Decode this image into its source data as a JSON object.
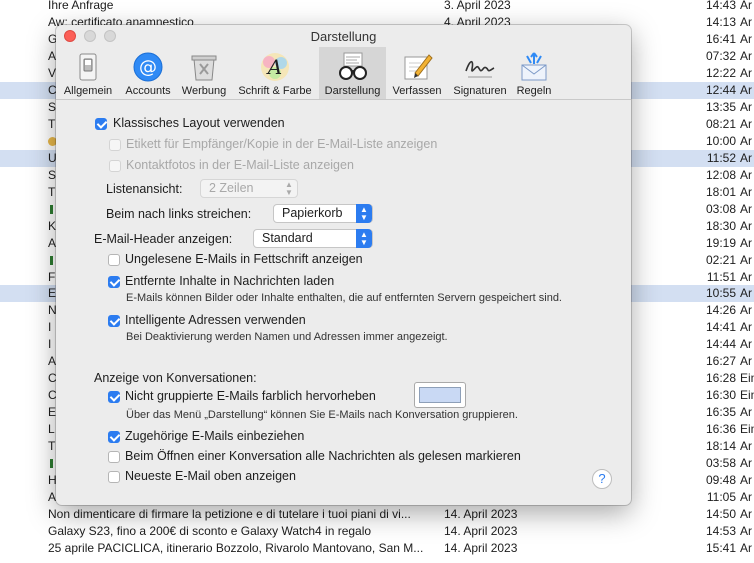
{
  "mail_list": [
    {
      "subject": "Ihre Anfrage",
      "date": "3. April 2023",
      "time": "14:43",
      "from": "Ar",
      "selected": false
    },
    {
      "subject": "Aw: certificato anamnestico",
      "date": "4. April 2023",
      "time": "14:13",
      "from": "Ar",
      "selected": false
    },
    {
      "subject": "G",
      "date": "",
      "time": "16:41",
      "from": "Ar",
      "selected": false
    },
    {
      "subject": "A",
      "date": "",
      "time": "07:32",
      "from": "Ar",
      "selected": false
    },
    {
      "subject": "V",
      "date": "",
      "time": "12:22",
      "from": "Ar",
      "selected": false
    },
    {
      "subject": "C",
      "date": "",
      "time": "12:44",
      "from": "Ar",
      "selected": true
    },
    {
      "subject": "S",
      "date": "",
      "time": "13:35",
      "from": "Ar",
      "selected": false
    },
    {
      "subject": "T",
      "date": "",
      "time": "08:21",
      "from": "Ar",
      "selected": false
    },
    {
      "subject": "",
      "date": "",
      "time": "10:00",
      "from": "Ar",
      "selected": false,
      "dot": true
    },
    {
      "subject": "U",
      "date": "",
      "time": "11:52",
      "from": "Ar",
      "selected": true
    },
    {
      "subject": "S",
      "date": "",
      "time": "12:08",
      "from": "Ar",
      "selected": false
    },
    {
      "subject": "T",
      "date": "",
      "time": "18:01",
      "from": "Ar",
      "selected": false
    },
    {
      "subject": "",
      "date": "",
      "time": "03:08",
      "from": "Ar",
      "selected": false,
      "flag": true
    },
    {
      "subject": "K",
      "date": "",
      "time": "18:30",
      "from": "Ar",
      "selected": false
    },
    {
      "subject": "A",
      "date": "",
      "time": "19:19",
      "from": "Ar",
      "selected": false
    },
    {
      "subject": "",
      "date": "",
      "time": "02:21",
      "from": "Ar",
      "selected": false,
      "flag": true
    },
    {
      "subject": "F",
      "date": "",
      "time": "11:51",
      "from": "Ar",
      "selected": false
    },
    {
      "subject": "E",
      "date": "",
      "time": "10:55",
      "from": "Ar",
      "selected": true
    },
    {
      "subject": "N",
      "date": "",
      "time": "14:26",
      "from": "Ar",
      "selected": false
    },
    {
      "subject": "I",
      "date": "",
      "time": "14:41",
      "from": "Ar",
      "selected": false
    },
    {
      "subject": "I",
      "date": "",
      "time": "14:44",
      "from": "Ar",
      "selected": false
    },
    {
      "subject": "A",
      "date": "",
      "time": "16:27",
      "from": "Ar",
      "selected": false
    },
    {
      "subject": "C",
      "date": "",
      "time": "16:28",
      "from": "Ein",
      "selected": false
    },
    {
      "subject": "C",
      "date": "",
      "time": "16:30",
      "from": "Ein",
      "selected": false
    },
    {
      "subject": "E",
      "date": "",
      "time": "16:35",
      "from": "Ar",
      "selected": false
    },
    {
      "subject": "L",
      "date": "",
      "time": "16:36",
      "from": "Ein",
      "selected": false
    },
    {
      "subject": "T",
      "date": "",
      "time": "18:14",
      "from": "Ar",
      "selected": false
    },
    {
      "subject": "",
      "date": "",
      "time": "03:58",
      "from": "Ar",
      "selected": false,
      "flag": true
    },
    {
      "subject": "H",
      "date": "",
      "time": "09:48",
      "from": "Ar",
      "selected": false
    },
    {
      "subject": "A",
      "date": "",
      "time": "11:05",
      "from": "Ar",
      "selected": false
    },
    {
      "subject": "Non dimenticare di firmare la petizione e di tutelare i tuoi piani di vi...",
      "date": "14. April 2023",
      "time": "14:50",
      "from": "Ar",
      "selected": false
    },
    {
      "subject": "Galaxy S23, fino a 200€ di sconto e Galaxy Watch4 in regalo",
      "date": "14. April 2023",
      "time": "14:53",
      "from": "Ar",
      "selected": false
    },
    {
      "subject": "25 aprile PACICLICA, itinerario Bozzolo, Rivarolo Mantovano, San M...",
      "date": "14. April 2023",
      "time": "15:41",
      "from": "Ar",
      "selected": false
    }
  ],
  "window": {
    "title": "Darstellung",
    "toolbar": [
      {
        "label": "Allgemein",
        "icon": "general-switch-icon",
        "active": false
      },
      {
        "label": "Accounts",
        "icon": "at-sign-icon",
        "active": false
      },
      {
        "label": "Werbung",
        "icon": "junk-trash-icon",
        "active": false
      },
      {
        "label": "Schrift & Farbe",
        "icon": "fonts-colors-icon",
        "active": false
      },
      {
        "label": "Darstellung",
        "icon": "glasses-icon",
        "active": true
      },
      {
        "label": "Verfassen",
        "icon": "pencil-paper-icon",
        "active": false
      },
      {
        "label": "Signaturen",
        "icon": "signature-icon",
        "active": false
      },
      {
        "label": "Regeln",
        "icon": "rules-envelope-icon",
        "active": false
      }
    ]
  },
  "settings": {
    "classic_layout": {
      "label": "Klassisches Layout verwenden",
      "checked": true
    },
    "label_recipient": {
      "label": "Etikett für Empfänger/Kopie in der E-Mail-Liste anzeigen",
      "checked": false,
      "disabled": true
    },
    "contact_photos": {
      "label": "Kontaktfotos in der E-Mail-Liste anzeigen",
      "checked": false,
      "disabled": true
    },
    "list_view": {
      "label": "Listenansicht:",
      "value": "2 Zeilen"
    },
    "swipe_left": {
      "label": "Beim nach links streichen:",
      "value": "Papierkorb"
    },
    "header_show": {
      "label": "E-Mail-Header anzeigen:",
      "value": "Standard"
    },
    "unread_bold": {
      "label": "Ungelesene E-Mails in Fettschrift anzeigen",
      "checked": false
    },
    "remote_content": {
      "label": "Entfernte Inhalte in Nachrichten laden",
      "checked": true,
      "note": "E-Mails können Bilder oder Inhalte enthalten, die auf entfernten Servern gespeichert sind."
    },
    "smart_addresses": {
      "label": "Intelligente Adressen verwenden",
      "checked": true,
      "note": "Bei Deaktivierung werden Namen und Adressen immer angezeigt."
    },
    "conversations_heading": "Anzeige von Konversationen:",
    "highlight_ungrouped": {
      "label": "Nicht gruppierte E-Mails farblich hervorheben",
      "checked": true,
      "note": "Über das Menü „Darstellung“ können Sie E-Mails nach Konversation gruppieren.",
      "color": "#c9d9f4"
    },
    "include_related": {
      "label": "Zugehörige E-Mails einbeziehen",
      "checked": true
    },
    "mark_read": {
      "label": "Beim Öffnen einer Konversation alle Nachrichten als gelesen markieren",
      "checked": false
    },
    "newest_top": {
      "label": "Neueste E-Mail oben anzeigen",
      "checked": false
    },
    "help_label": "?"
  },
  "colors": {
    "accent": "#2c7cf0",
    "selection": "#d3dff2",
    "window_bg": "#ececec"
  }
}
